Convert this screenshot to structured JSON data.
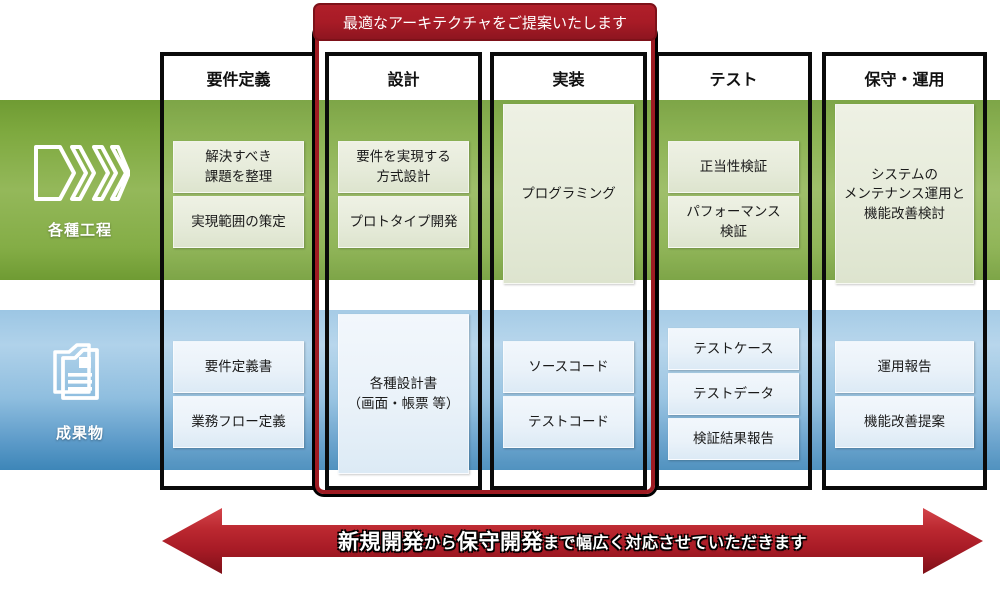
{
  "banner": {
    "text": "最適なアーキテクチャをご提案いたします",
    "color": "#a81b26"
  },
  "row_labels": [
    {
      "id": "processes",
      "text": "各種工程",
      "icon": "chevrons-icon",
      "color": "#7ea93f"
    },
    {
      "id": "deliverables",
      "text": "成果物",
      "icon": "documents-icon",
      "color": "#5d9bc9"
    }
  ],
  "columns": [
    {
      "header": "要件定義",
      "processes": [
        "解決すべき\n課題を整理",
        "実現範囲の策定"
      ],
      "deliverables": [
        "要件定義書",
        "業務フロー定義"
      ]
    },
    {
      "header": "設計",
      "processes": [
        "要件を実現する\n方式設計",
        "プロトタイプ開発"
      ],
      "deliverables": [
        "各種設計書\n（画面・帳票 等）"
      ]
    },
    {
      "header": "実装",
      "processes": [
        "プログラミング"
      ],
      "deliverables": [
        "ソースコード",
        "テストコード"
      ]
    },
    {
      "header": "テスト",
      "processes": [
        "正当性検証",
        "パフォーマンス\n検証"
      ],
      "deliverables": [
        "テストケース",
        "テストデータ",
        "検証結果報告"
      ]
    },
    {
      "header": "保守・運用",
      "processes": [
        "システムの\nメンテナンス運用と\n機能改善検討"
      ],
      "deliverables": [
        "運用報告",
        "機能改善提案"
      ]
    }
  ],
  "bottom_arrow": {
    "text_parts": [
      {
        "t": "新規開発",
        "size": "large"
      },
      {
        "t": "から",
        "size": "small"
      },
      {
        "t": "保守開発",
        "size": "large"
      },
      {
        "t": "まで幅広く対応させていただきます",
        "size": "small"
      }
    ],
    "full_text": "新規開発から保守開発まで幅広く対応させていただきます",
    "color": "#a81b26",
    "direction": "double"
  },
  "highlight": {
    "spans": [
      "設計",
      "実装"
    ],
    "color": "#9e1b22"
  }
}
